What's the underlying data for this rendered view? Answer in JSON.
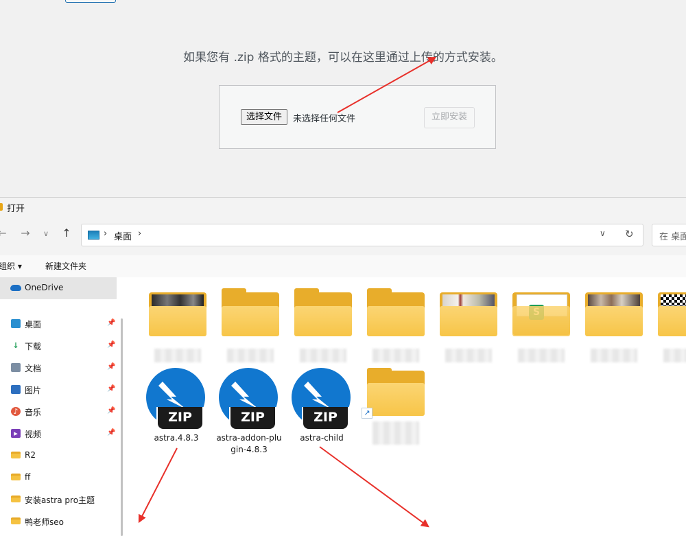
{
  "upload": {
    "help_text": "如果您有 .zip 格式的主题，可以在这里通过上传的方式安装。",
    "choose_file_label": "选择文件",
    "file_status": "未选择任何文件",
    "install_label": "立即安装"
  },
  "dialog": {
    "title": "打开",
    "address": {
      "crumb": "桌面"
    },
    "search_placeholder": "在 桌面",
    "toolbar": {
      "organize_label": "组织 ▾",
      "new_folder_label": "新建文件夹"
    },
    "nav": {
      "onedrive_label": "OneDrive",
      "items": [
        {
          "label": "桌面",
          "icon": "desktop-icon",
          "pinned": true
        },
        {
          "label": "下载",
          "icon": "download-icon",
          "pinned": true
        },
        {
          "label": "文档",
          "icon": "document-icon",
          "pinned": true
        },
        {
          "label": "图片",
          "icon": "pictures-icon",
          "pinned": true
        },
        {
          "label": "音乐",
          "icon": "music-icon",
          "pinned": true
        },
        {
          "label": "视频",
          "icon": "video-icon",
          "pinned": true
        },
        {
          "label": "R2",
          "icon": "folder-icon",
          "pinned": false
        },
        {
          "label": "ff",
          "icon": "folder-icon",
          "pinned": false
        },
        {
          "label": "安装astra pro主题",
          "icon": "folder-icon",
          "pinned": false
        },
        {
          "label": "鸭老师seo",
          "icon": "folder-icon",
          "pinned": false
        }
      ]
    },
    "files": [
      {
        "name": "astra.4.8.3",
        "type": "zip"
      },
      {
        "name": "astra-addon-plugin-4.8.3",
        "type": "zip"
      },
      {
        "name": "astra-child",
        "type": "zip"
      }
    ],
    "zip_badge": "ZIP"
  },
  "colors": {
    "accent": "#1177cf",
    "annotation_arrow": "#e8302a",
    "folder": "#f7c548"
  }
}
